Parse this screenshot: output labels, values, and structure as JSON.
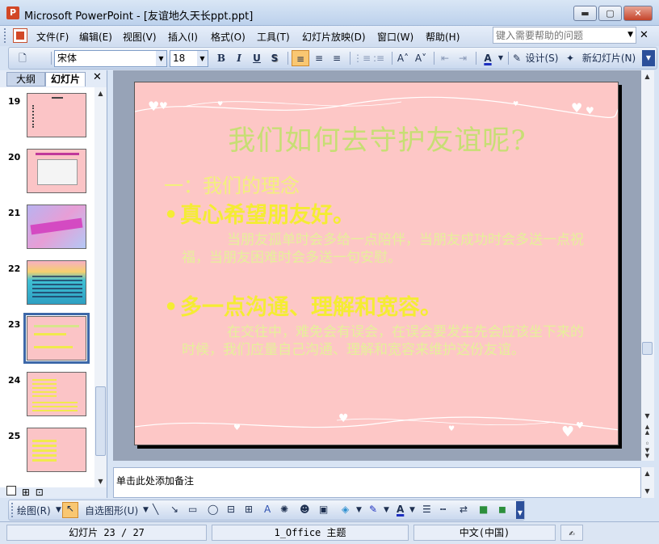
{
  "window": {
    "title": "Microsoft PowerPoint - [友谊地久天长ppt.ppt]",
    "min_glyph": "▬",
    "max_glyph": "▢",
    "close_glyph": "✕"
  },
  "menu": {
    "items": [
      "文件(F)",
      "编辑(E)",
      "视图(V)",
      "插入(I)",
      "格式(O)",
      "工具(T)",
      "幻灯片放映(D)",
      "窗口(W)",
      "帮助(H)"
    ],
    "help_placeholder": "键入需要帮助的问题",
    "close_glyph": "✕"
  },
  "format_toolbar": {
    "font_name": "宋体",
    "font_size": "18",
    "bold": "B",
    "italic": "I",
    "underline": "U",
    "shadow": "S",
    "design_label": "设计(S)",
    "new_slide_label": "新幻灯片(N)"
  },
  "left_pane": {
    "tab_outline": "大纲",
    "tab_slides": "幻灯片",
    "close_glyph": "✕",
    "slides": [
      {
        "number": "19"
      },
      {
        "number": "20"
      },
      {
        "number": "21"
      },
      {
        "number": "22"
      },
      {
        "number": "23",
        "selected": true
      },
      {
        "number": "24"
      },
      {
        "number": "25"
      }
    ]
  },
  "slide": {
    "title": "我们如何去守护友谊呢?",
    "subtitle": "一：我们的理念",
    "bullet1": "真心希望朋友好。",
    "body1": "当朋友孤单时会多给一点陪伴，当朋友成功时会多送一点祝福，当朋友困难时会多送一句安慰。",
    "bullet2": "多一点沟通、理解和宽容。",
    "body2": "在交往中，难免会有误会，在误会要发生先会应该坐下来的时候，我们应量自己沟通、理解和宽容来维护这份友谊。",
    "bullet_glyph": "•"
  },
  "notes": {
    "placeholder": "单击此处添加备注"
  },
  "draw_toolbar": {
    "draw_label": "绘图(R)",
    "autoshapes_label": "自选图形(U)"
  },
  "status": {
    "slide_position": "幻灯片 23 / 27",
    "theme": "1_Office 主题",
    "language": "中文(中国)"
  },
  "colors": {
    "slide_background": "#fdc7c6",
    "title_text": "#c7de74",
    "bullet_text": "#f4ec33",
    "accent_orange": "#f9c772"
  }
}
